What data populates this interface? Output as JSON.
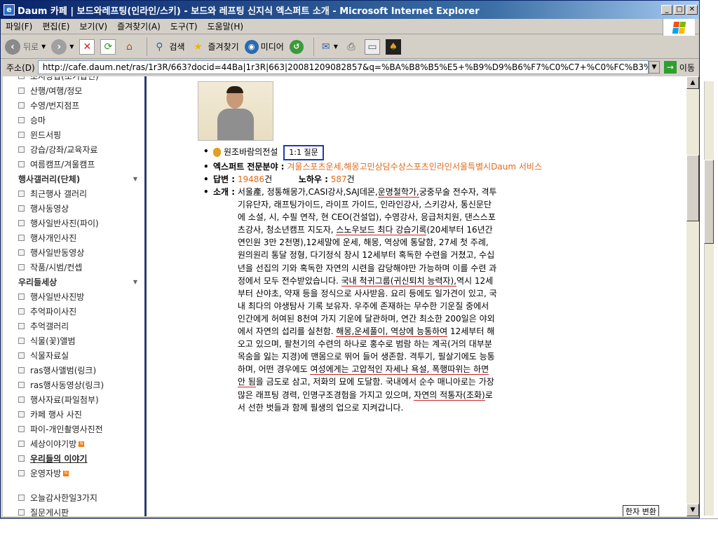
{
  "window": {
    "title": "Daum 카페 | 보드와레프팅(인라인/스키) - 보드와 레프팅 신지식 엑스퍼트 소개 - Microsoft Internet Explorer",
    "controls": [
      "_",
      "□",
      "✕"
    ]
  },
  "menu": [
    "파일(F)",
    "편집(E)",
    "보기(V)",
    "즐겨찾기(A)",
    "도구(T)",
    "도움말(H)"
  ],
  "toolbar": {
    "back": "뒤로",
    "search": "검색",
    "favorites": "즐겨찾기",
    "media": "미디어"
  },
  "address": {
    "label": "주소(D)",
    "url": "http://cafe.daum.net/ras/1r3R/663?docid=44Ba|1r3R|663|20081209082857&q=%BA%B8%B5%E5+%B9%D9%B6%F7%C0%C7+%C0%FC%B3%B0%E",
    "go": "이동"
  },
  "sidebar": {
    "items": [
      {
        "type": "item",
        "label": "초지방답(초기답변)"
      },
      {
        "type": "item",
        "label": "산행/여행/정모"
      },
      {
        "type": "item",
        "label": "수영/번지점프"
      },
      {
        "type": "item",
        "label": "승마"
      },
      {
        "type": "item",
        "label": "윈드서핑"
      },
      {
        "type": "item",
        "label": "강습/강좌/교육자료"
      },
      {
        "type": "item",
        "label": "여름캠프/겨울캠프"
      },
      {
        "type": "header",
        "label": "행사갤러리(단체)"
      },
      {
        "type": "item",
        "label": "최근행사 갤러리"
      },
      {
        "type": "item",
        "label": "행사동영상"
      },
      {
        "type": "item",
        "label": "행사일반사진(파이)"
      },
      {
        "type": "item",
        "label": "행사개인사진"
      },
      {
        "type": "item",
        "label": "행사일반동영상"
      },
      {
        "type": "item",
        "label": "작품/시범/컨셉"
      },
      {
        "type": "header",
        "label": "우리들세상"
      },
      {
        "type": "item",
        "label": "행사일반사진방"
      },
      {
        "type": "item",
        "label": "추억파이사진"
      },
      {
        "type": "item",
        "label": "추억갤러리"
      },
      {
        "type": "item",
        "label": "식물(꽃)앨범"
      },
      {
        "type": "item",
        "label": "식물자료실"
      },
      {
        "type": "item",
        "label": "ras행사앨범(링크)"
      },
      {
        "type": "item",
        "label": "ras행사동영상(링크)"
      },
      {
        "type": "item",
        "label": "행사자료(파일첨부)"
      },
      {
        "type": "item",
        "label": "카페 행사 사진"
      },
      {
        "type": "item",
        "label": "파이-개인촬영사진전"
      },
      {
        "type": "item",
        "label": "세상이야기방",
        "new": true
      },
      {
        "type": "item",
        "label": "우리들의 이야기",
        "bold": true
      },
      {
        "type": "item",
        "label": "운영자방",
        "new": true
      },
      {
        "type": "gap",
        "label": ""
      },
      {
        "type": "item",
        "label": "오늘감사한일3가지"
      },
      {
        "type": "item",
        "label": "질문게시판"
      }
    ]
  },
  "profile": {
    "name": "원조바람의전설",
    "question_button": "1:1 질문",
    "field_label": "엑스퍼트 전문분야 :",
    "field_value": "겨울스포츠운세,해몽고민상담수상스포츠인라인서울특별시Daum 서비스",
    "answers_label": "답변 :",
    "answers_value": "19486",
    "answers_unit": "건",
    "knowhow_label": "노하우 :",
    "knowhow_value": "587",
    "knowhow_unit": "건",
    "intro_label": "소개 :",
    "intro_parts": [
      {
        "t": "서울產, 정통해몽가,CASI강사,SAJ데몬,",
        "u": false
      },
      {
        "t": "운명철학가,",
        "u": true
      },
      {
        "t": "궁중무술 전수자, 격투기유단자, 래프팅가이드, 라이프 가이드, 인라인강사, 스키강사, 통신문단에 소설, 시, 수필 연작, 현 CEO(건설업), 수영강사, 응급처치원, 댄스스포츠강사, 청소년캠프 지도자, ",
        "u": false
      },
      {
        "t": "스노우보드 최다 강습기록",
        "u": true
      },
      {
        "t": "(20세부터 16년간 연인원 3만 2천명),12세말에 운세, 해몽, 역상에 통달함, 27세 첫 주례, 원의원리 통달 정형, 다기정식 창시 12세부터 혹독한 수련을 거쳤고, 수십 년을 선집의 기와 혹독한 자연의 시련을 감당해야만 가능하며 이를 수련 과정에서 모두 전수받았습니다. ",
        "u": false
      },
      {
        "t": "국내 척귀그룹(귀신퇴치 능력자),",
        "u": true
      },
      {
        "t": "역시 12세부터 산야초, 약재 등을 정식으로 사사받음. 요리 등에도 일가견이 있고, 국내 최다의 야생탐사 기록 보유자. 우주에 존재하는 무수한 기운질 중에서 인간에게 허여된 8천여 가지 기운에 달관하며, 연간 최소한 200일은 야외에서 자연의 섭리를 실천함. ",
        "u": false
      },
      {
        "t": "해몽,운세풀이, 역상에 능통하여",
        "u": true
      },
      {
        "t": " 12세부터 해오고 있으며, 팔천기의 수련의 하나로 홍수로 범람 하는 계곡(거의 대부분 목숨을 잃는 지경)에 맨몸으로 뛰어 들어 생존함. 격투기, 필살기에도 능통하며, 어떤 경우에도 ",
        "u": false
      },
      {
        "t": "여성에게는 고압적인 자세나 욕설, 폭행따위는 하면 안 됨",
        "u": true
      },
      {
        "t": "을 금도로 삼고, 저화의 묘에 도달함. 국내에서 순수 매니아로는 가장 많은 래프팅 경력, 인명구조경험을 가지고 있으며, ",
        "u": false
      },
      {
        "t": "자연의 적통자(조화)",
        "u": true
      },
      {
        "t": "로서 선한 벗들과 함께 필생의 업으로 지켜갑니다.",
        "u": false
      }
    ]
  },
  "hanja_button": "한자 변환",
  "colors": {
    "titlebar_start": "#0a246a",
    "titlebar_end": "#a6caf0",
    "chrome": "#d4d0c8",
    "sidebar_border": "#263d6e",
    "orange": "#e06a1a",
    "underline": "#d02020",
    "question_border": "#1b3cb0"
  }
}
